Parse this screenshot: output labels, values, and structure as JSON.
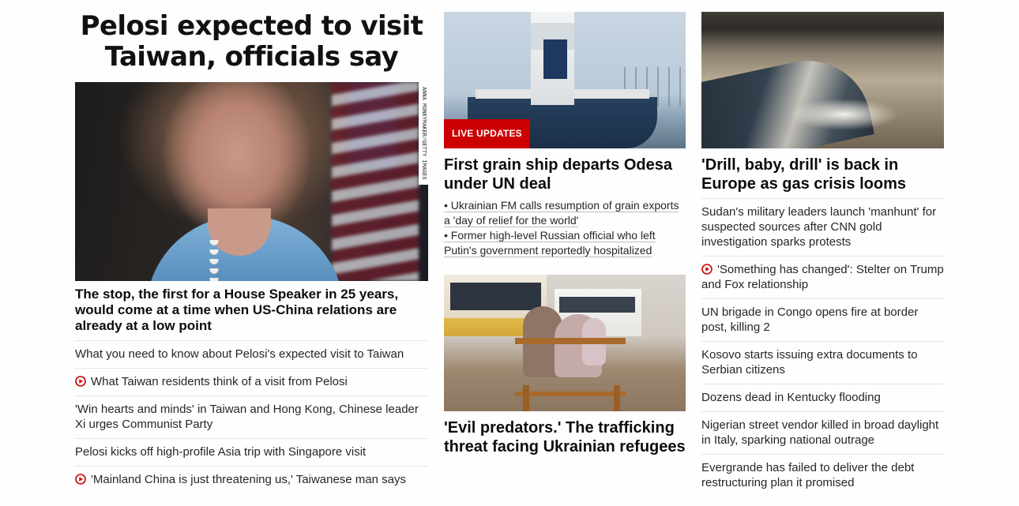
{
  "lead": {
    "headline": "Pelosi expected to visit Taiwan, officials say",
    "photo_credit": "ANNA MONEYMAKER/GETTY IMAGES",
    "subheadline": "The stop, the first for a House Speaker in 25 years, would come at a time when US-China relations are already at a low point",
    "related": [
      {
        "text": "What you need to know about Pelosi's expected visit to Taiwan",
        "video": false
      },
      {
        "text": "What Taiwan residents think of a visit from Pelosi",
        "video": true
      },
      {
        "text": "'Win hearts and minds' in Taiwan and Hong Kong, Chinese leader Xi urges Communist Party",
        "video": false
      },
      {
        "text": "Pelosi kicks off high-profile Asia trip with Singapore visit",
        "video": false
      },
      {
        "text": "'Mainland China is just threatening us,' Taiwanese man says",
        "video": true
      }
    ]
  },
  "grain": {
    "badge": "LIVE UPDATES",
    "headline": "First grain ship departs Odesa under UN deal",
    "bullets": [
      "• Ukrainian FM calls resumption of grain exports a 'day of relief for the world'",
      "• Former high-level Russian official who left Putin's government reportedly hospitalized"
    ]
  },
  "refugees": {
    "headline": "'Evil predators.' The trafficking threat facing Ukrainian refugees"
  },
  "drill": {
    "headline": "'Drill, baby, drill' is back in Europe as gas crisis looms",
    "stories": [
      {
        "text": "Sudan's military leaders launch 'manhunt' for suspected sources after CNN gold investigation sparks protests",
        "video": false
      },
      {
        "text": "'Something has changed': Stelter on Trump and Fox relationship",
        "video": true
      },
      {
        "text": "UN brigade in Congo opens fire at border post, killing 2",
        "video": false
      },
      {
        "text": "Kosovo starts issuing extra documents to Serbian citizens",
        "video": false
      },
      {
        "text": "Dozens dead in Kentucky flooding",
        "video": false
      },
      {
        "text": "Nigerian street vendor killed in broad daylight in Italy, sparking national outrage",
        "video": false
      },
      {
        "text": "Evergrande has failed to deliver the debt restructuring plan it promised",
        "video": false
      }
    ]
  },
  "colors": {
    "accent_red": "#cc0000",
    "text_dark": "#0c0c0c",
    "divider": "#e6e6e6"
  },
  "icons": {
    "video": "play-circle-icon"
  }
}
